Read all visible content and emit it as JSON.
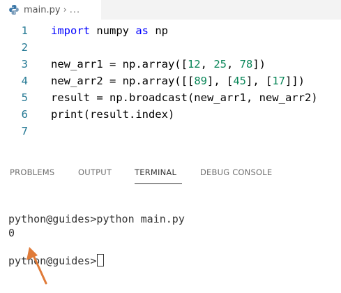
{
  "tab": {
    "filename": "main.py",
    "separator": "›",
    "crumbs": "..."
  },
  "editor": {
    "lines": [
      {
        "num": "1",
        "parts": [
          {
            "t": "import",
            "c": "kw"
          },
          {
            "t": " numpy ",
            "c": ""
          },
          {
            "t": "as",
            "c": "kw"
          },
          {
            "t": " np",
            "c": ""
          }
        ]
      },
      {
        "num": "2",
        "parts": []
      },
      {
        "num": "3",
        "parts": [
          {
            "t": "new_arr1 = np.array([",
            "c": ""
          },
          {
            "t": "12",
            "c": "num"
          },
          {
            "t": ", ",
            "c": ""
          },
          {
            "t": "25",
            "c": "num"
          },
          {
            "t": ", ",
            "c": ""
          },
          {
            "t": "78",
            "c": "num"
          },
          {
            "t": "])",
            "c": ""
          }
        ]
      },
      {
        "num": "4",
        "parts": [
          {
            "t": "new_arr2 = np.array([[",
            "c": ""
          },
          {
            "t": "89",
            "c": "num"
          },
          {
            "t": "], [",
            "c": ""
          },
          {
            "t": "45",
            "c": "num"
          },
          {
            "t": "], [",
            "c": ""
          },
          {
            "t": "17",
            "c": "num"
          },
          {
            "t": "]])",
            "c": ""
          }
        ]
      },
      {
        "num": "5",
        "parts": [
          {
            "t": "result = np.broadcast(new_arr1, new_arr2)",
            "c": ""
          }
        ]
      },
      {
        "num": "6",
        "parts": [
          {
            "t": "print(result.index)",
            "c": ""
          }
        ]
      },
      {
        "num": "7",
        "parts": []
      }
    ]
  },
  "panel": {
    "tabs": {
      "problems": "PROBLEMS",
      "output": "OUTPUT",
      "terminal": "TERMINAL",
      "debug": "DEBUG CONSOLE"
    },
    "active_tab": "TERMINAL"
  },
  "terminal": {
    "command_line": "python@guides>python main.py",
    "output": "0",
    "prompt": "python@guides>"
  },
  "colors": {
    "keyword": "#0000ff",
    "number": "#098658",
    "line_number": "#237893",
    "annotation_arrow": "#e07b39"
  },
  "icons": {
    "file_icon": "python-file-icon",
    "annotation": "arrow-annotation"
  }
}
